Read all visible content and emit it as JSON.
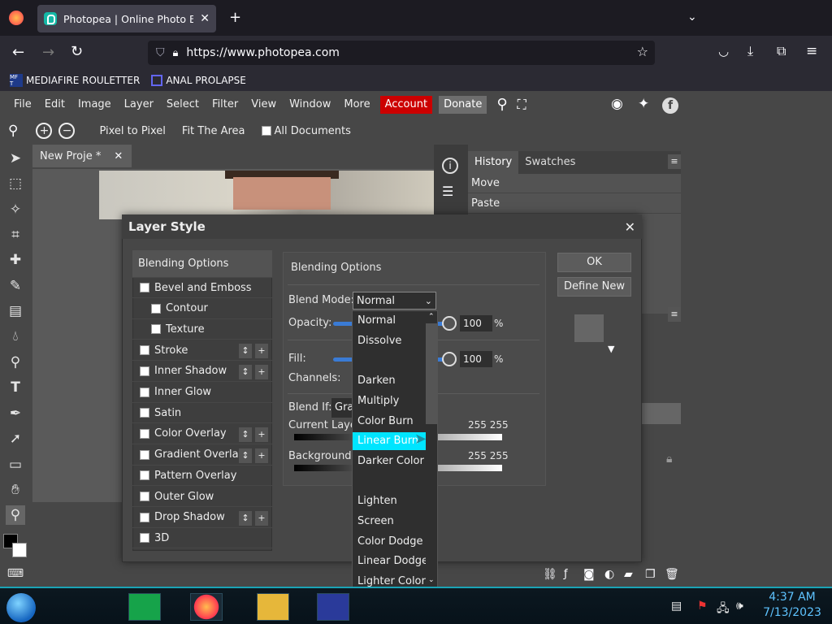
{
  "browser": {
    "tab_title": "Photopea | Online Photo Editor",
    "url": "https://www.photopea.com",
    "bookmarks": [
      "MEDIAFIRE ROULETTER",
      "ANAL PROLAPSE"
    ],
    "bookmark_icon_text": "MF T"
  },
  "menu": {
    "items": [
      "File",
      "Edit",
      "Image",
      "Layer",
      "Select",
      "Filter",
      "View",
      "Window",
      "More"
    ],
    "account": "Account",
    "donate": "Donate"
  },
  "options": {
    "pixel_to_pixel": "Pixel to Pixel",
    "fit_area": "Fit The Area",
    "all_documents": "All Documents"
  },
  "document": {
    "tab_label": "New Proje",
    "modified": "*"
  },
  "history_panel": {
    "tabs": [
      "History",
      "Swatches"
    ],
    "items": [
      "Move",
      "Paste"
    ]
  },
  "dialog": {
    "title": "Layer Style",
    "styles": [
      {
        "label": "Blending Options",
        "type": "header"
      },
      {
        "label": "Bevel and Emboss",
        "type": "check"
      },
      {
        "label": "Contour",
        "type": "sub"
      },
      {
        "label": "Texture",
        "type": "sub"
      },
      {
        "label": "Stroke",
        "type": "check",
        "extras": true
      },
      {
        "label": "Inner Shadow",
        "type": "check",
        "extras": true
      },
      {
        "label": "Inner Glow",
        "type": "check"
      },
      {
        "label": "Satin",
        "type": "check"
      },
      {
        "label": "Color Overlay",
        "type": "check",
        "extras": true
      },
      {
        "label": "Gradient Overlay",
        "type": "check",
        "extras": true
      },
      {
        "label": "Pattern Overlay",
        "type": "check"
      },
      {
        "label": "Outer Glow",
        "type": "check"
      },
      {
        "label": "Drop Shadow",
        "type": "check",
        "extras": true
      },
      {
        "label": "3D",
        "type": "check"
      }
    ],
    "panel_title": "Blending Options",
    "blend_mode_label": "Blend Mode:",
    "blend_mode_value": "Normal",
    "opacity_label": "Opacity:",
    "opacity_value": "100",
    "percent": "%",
    "fill_label": "Fill:",
    "fill_value": "100",
    "channels_label": "Channels:",
    "blend_if_label": "Blend If:",
    "blend_if_value": "Gra",
    "current_layer_label": "Current Laye",
    "current_layer_range": "255 255",
    "background_label": "Background:",
    "background_range": "255 255",
    "ok_label": "OK",
    "define_new_label": "Define New"
  },
  "blend_dropdown": {
    "options": [
      {
        "label": "Normal"
      },
      {
        "label": "Dissolve"
      },
      {
        "label": ""
      },
      {
        "label": "Darken"
      },
      {
        "label": "Multiply"
      },
      {
        "label": "Color Burn"
      },
      {
        "label": "Linear Burn",
        "highlighted": true
      },
      {
        "label": "Darker Color"
      },
      {
        "label": ""
      },
      {
        "label": "Lighten"
      },
      {
        "label": "Screen"
      },
      {
        "label": "Color Dodge"
      },
      {
        "label": "Linear Dodge"
      },
      {
        "label": "Lighter Color"
      }
    ]
  },
  "taskbar": {
    "time": "4:37 AM",
    "date": "7/13/2023"
  }
}
